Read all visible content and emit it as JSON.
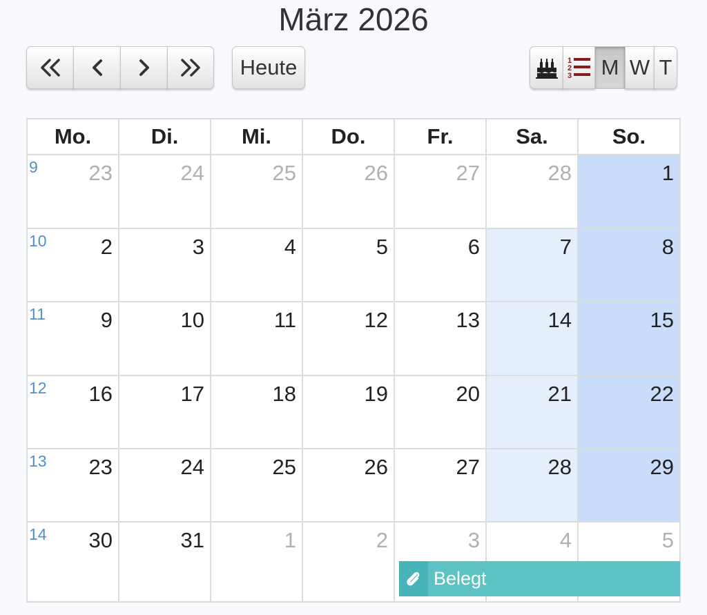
{
  "title": "März 2026",
  "toolbar": {
    "nav_first_icon": "double-chevron-left-icon",
    "nav_prev_icon": "chevron-left-icon",
    "nav_next_icon": "chevron-right-icon",
    "nav_last_icon": "double-chevron-right-icon",
    "today_label": "Heute",
    "view_birthday_icon": "birthday-cake-icon",
    "view_list_icon": "numbered-list-icon",
    "view_month": "M",
    "view_week": "W",
    "view_day": "T",
    "active_view": "M"
  },
  "weekdays": [
    "Mo.",
    "Di.",
    "Mi.",
    "Do.",
    "Fr.",
    "Sa.",
    "So."
  ],
  "weeks": [
    {
      "num": "9",
      "days": [
        "23",
        "24",
        "25",
        "26",
        "27",
        "28",
        "1"
      ]
    },
    {
      "num": "10",
      "days": [
        "2",
        "3",
        "4",
        "5",
        "6",
        "7",
        "8"
      ]
    },
    {
      "num": "11",
      "days": [
        "9",
        "10",
        "11",
        "12",
        "13",
        "14",
        "15"
      ]
    },
    {
      "num": "12",
      "days": [
        "16",
        "17",
        "18",
        "19",
        "20",
        "21",
        "22"
      ]
    },
    {
      "num": "13",
      "days": [
        "23",
        "24",
        "25",
        "26",
        "27",
        "28",
        "29"
      ]
    },
    {
      "num": "14",
      "days": [
        "30",
        "31",
        "1",
        "2",
        "3",
        "4",
        "5"
      ]
    }
  ],
  "event": {
    "label": "Belegt",
    "icon": "paperclip-icon",
    "color": "#5cc2c6"
  },
  "colors": {
    "weekend_saturday": "#e5effc",
    "weekend_sunday": "#c9dcfa",
    "week_number": "#4f8fcf",
    "other_month_text": "#b0b0b0"
  }
}
